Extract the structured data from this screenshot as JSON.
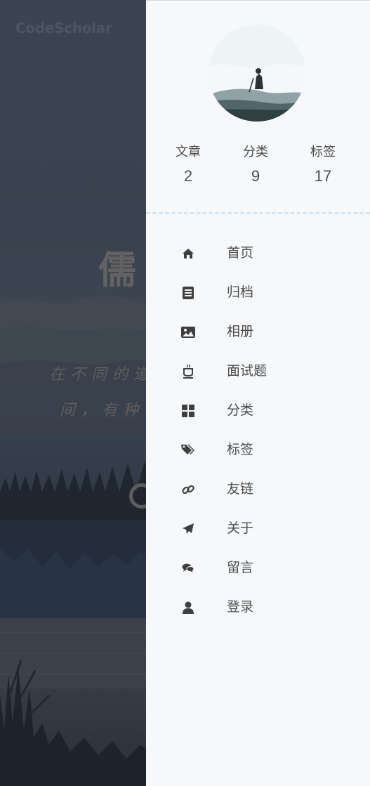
{
  "background": {
    "brand": "CodeScholar",
    "hero_title": "儒",
    "hero_lines": [
      "在不同的道",
      "间，有种"
    ]
  },
  "drawer": {
    "avatar_alt": "avatar",
    "stats": [
      {
        "label": "文章",
        "value": "2"
      },
      {
        "label": "分类",
        "value": "9"
      },
      {
        "label": "标签",
        "value": "17"
      }
    ],
    "menu": [
      {
        "label": "首页",
        "icon": "home-icon"
      },
      {
        "label": "归档",
        "icon": "archive-icon"
      },
      {
        "label": "相册",
        "icon": "image-icon"
      },
      {
        "label": "面试题",
        "icon": "cup-icon"
      },
      {
        "label": "分类",
        "icon": "grid-icon"
      },
      {
        "label": "标签",
        "icon": "tags-icon"
      },
      {
        "label": "友链",
        "icon": "link-icon"
      },
      {
        "label": "关于",
        "icon": "paper-plane-icon"
      },
      {
        "label": "留言",
        "icon": "comments-icon"
      },
      {
        "label": "登录",
        "icon": "user-icon"
      }
    ]
  },
  "colors": {
    "drawer_bg": "#f6f8fa",
    "text": "#4c4c4c",
    "divider": "#d5e7f5"
  }
}
